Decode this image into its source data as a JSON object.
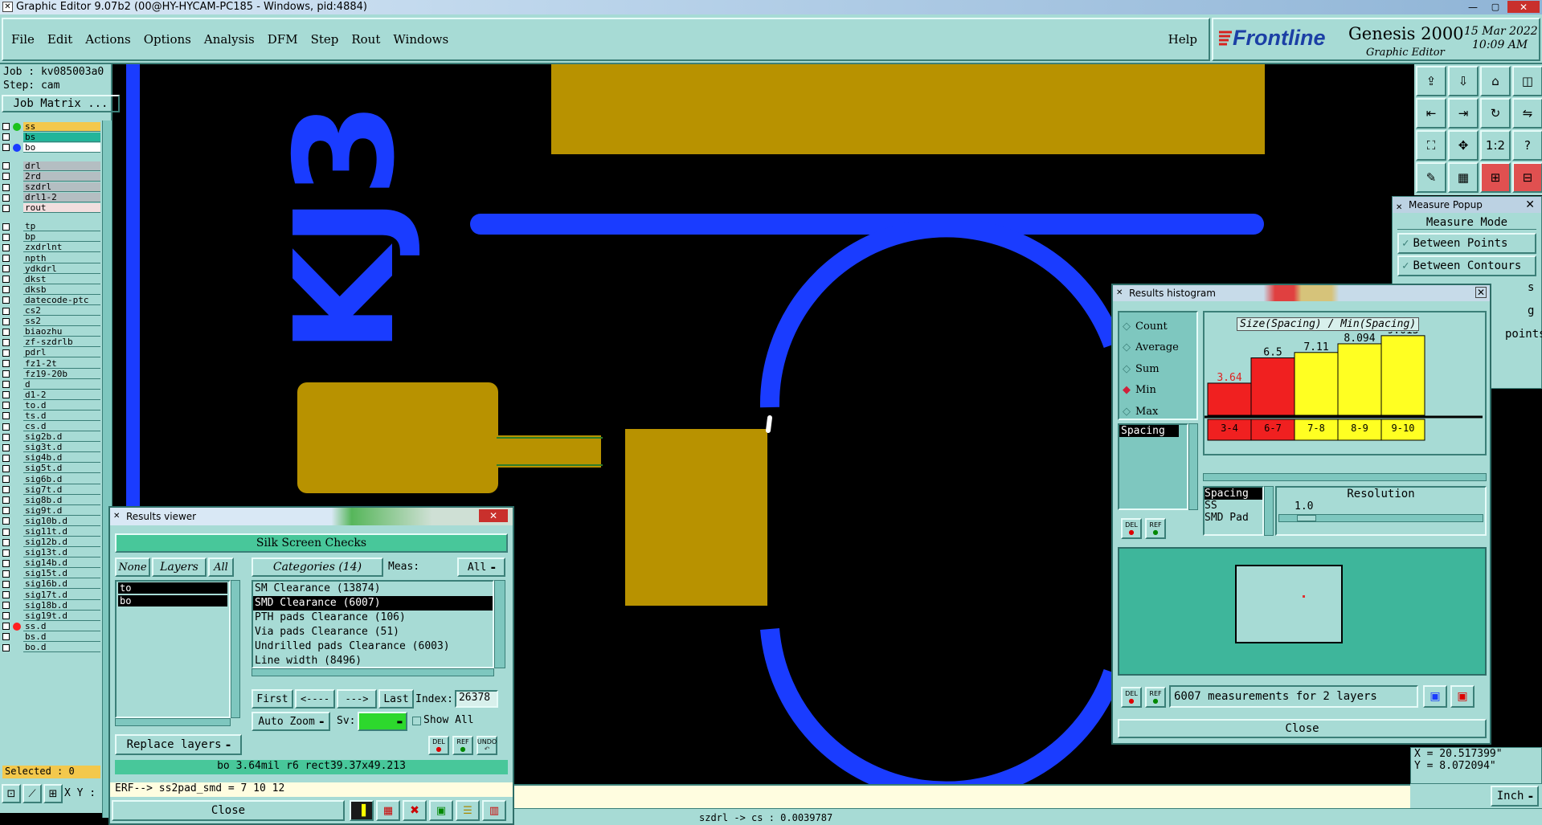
{
  "window": {
    "title": "Graphic Editor 9.07b2 (00@HY-HYCAM-PC185 - Windows, pid:4884)"
  },
  "menubar": {
    "items": [
      "File",
      "Edit",
      "Actions",
      "Options",
      "Analysis",
      "DFM",
      "Step",
      "Rout",
      "Windows"
    ],
    "help": "Help"
  },
  "brand": {
    "logo": "Frontline",
    "product": "Genesis 2000",
    "subtitle": "Graphic Editor",
    "date": "15 Mar 2022",
    "time": "10:09 AM"
  },
  "job": {
    "job": "Job : kv085003a0",
    "step": "Step: cam",
    "matrix_button": "Job Matrix ...",
    "selected": "Selected : 0"
  },
  "layers": [
    {
      "name": "ss",
      "bg": "#f3c84c",
      "dot": "#1cc21c",
      "flag": "="
    },
    {
      "name": "bs",
      "bg": "#22b59a",
      "dot": "",
      "flag": ""
    },
    {
      "name": "bo",
      "bg": "#ffffff",
      "dot": "#1a3cff",
      "flag": "◢"
    },
    {
      "name": "drl",
      "bg": "#b4bec2",
      "dot": "",
      "flag": ""
    },
    {
      "name": "2rd",
      "bg": "#b4bec2",
      "dot": "",
      "flag": ""
    },
    {
      "name": "szdrl",
      "bg": "#b4bec2",
      "dot": "",
      "flag": ""
    },
    {
      "name": "drl1-2",
      "bg": "#b4bec2",
      "dot": "",
      "flag": ""
    },
    {
      "name": "rout",
      "bg": "#f2dede",
      "dot": "",
      "flag": ""
    },
    {
      "name": "tp",
      "bg": "#a7dbd5",
      "dot": "",
      "flag": ""
    },
    {
      "name": "bp",
      "bg": "#a7dbd5",
      "dot": "",
      "flag": ""
    },
    {
      "name": "zxdrlnt",
      "bg": "#a7dbd5",
      "dot": "",
      "flag": ""
    },
    {
      "name": "npth",
      "bg": "#a7dbd5",
      "dot": "",
      "flag": ""
    },
    {
      "name": "ydkdrl",
      "bg": "#a7dbd5",
      "dot": "",
      "flag": ""
    },
    {
      "name": "dkst",
      "bg": "#a7dbd5",
      "dot": "",
      "flag": ""
    },
    {
      "name": "dksb",
      "bg": "#a7dbd5",
      "dot": "",
      "flag": ""
    },
    {
      "name": "datecode-ptc",
      "bg": "#a7dbd5",
      "dot": "",
      "flag": ""
    },
    {
      "name": "cs2",
      "bg": "#a7dbd5",
      "dot": "",
      "flag": ""
    },
    {
      "name": "ss2",
      "bg": "#a7dbd5",
      "dot": "",
      "flag": ""
    },
    {
      "name": "biaozhu",
      "bg": "#a7dbd5",
      "dot": "",
      "flag": ""
    },
    {
      "name": "zf-szdrlb",
      "bg": "#a7dbd5",
      "dot": "",
      "flag": ""
    },
    {
      "name": "pdrl",
      "bg": "#a7dbd5",
      "dot": "",
      "flag": ""
    },
    {
      "name": "fz1-2t",
      "bg": "#a7dbd5",
      "dot": "",
      "flag": ""
    },
    {
      "name": "fz19-20b",
      "bg": "#a7dbd5",
      "dot": "",
      "flag": ""
    },
    {
      "name": "d",
      "bg": "#a7dbd5",
      "dot": "",
      "flag": ""
    },
    {
      "name": "d1-2",
      "bg": "#a7dbd5",
      "dot": "",
      "flag": ""
    },
    {
      "name": "to.d",
      "bg": "#a7dbd5",
      "dot": "",
      "flag": "◢"
    },
    {
      "name": "ts.d",
      "bg": "#a7dbd5",
      "dot": "",
      "flag": "◢"
    },
    {
      "name": "cs.d",
      "bg": "#a7dbd5",
      "dot": "",
      "flag": ""
    },
    {
      "name": "sig2b.d",
      "bg": "#a7dbd5",
      "dot": "",
      "flag": ""
    },
    {
      "name": "sig3t.d",
      "bg": "#a7dbd5",
      "dot": "",
      "flag": ""
    },
    {
      "name": "sig4b.d",
      "bg": "#a7dbd5",
      "dot": "",
      "flag": ""
    },
    {
      "name": "sig5t.d",
      "bg": "#a7dbd5",
      "dot": "",
      "flag": ""
    },
    {
      "name": "sig6b.d",
      "bg": "#a7dbd5",
      "dot": "",
      "flag": ""
    },
    {
      "name": "sig7t.d",
      "bg": "#a7dbd5",
      "dot": "",
      "flag": ""
    },
    {
      "name": "sig8b.d",
      "bg": "#a7dbd5",
      "dot": "",
      "flag": ""
    },
    {
      "name": "sig9t.d",
      "bg": "#a7dbd5",
      "dot": "",
      "flag": ""
    },
    {
      "name": "sig10b.d",
      "bg": "#a7dbd5",
      "dot": "",
      "flag": ""
    },
    {
      "name": "sig11t.d",
      "bg": "#a7dbd5",
      "dot": "",
      "flag": ""
    },
    {
      "name": "sig12b.d",
      "bg": "#a7dbd5",
      "dot": "",
      "flag": ""
    },
    {
      "name": "sig13t.d",
      "bg": "#a7dbd5",
      "dot": "",
      "flag": ""
    },
    {
      "name": "sig14b.d",
      "bg": "#a7dbd5",
      "dot": "",
      "flag": ""
    },
    {
      "name": "sig15t.d",
      "bg": "#a7dbd5",
      "dot": "",
      "flag": ""
    },
    {
      "name": "sig16b.d",
      "bg": "#a7dbd5",
      "dot": "",
      "flag": ""
    },
    {
      "name": "sig17t.d",
      "bg": "#a7dbd5",
      "dot": "",
      "flag": ""
    },
    {
      "name": "sig18b.d",
      "bg": "#a7dbd5",
      "dot": "",
      "flag": ""
    },
    {
      "name": "sig19t.d",
      "bg": "#a7dbd5",
      "dot": "",
      "flag": ""
    },
    {
      "name": "ss.d",
      "bg": "#a7dbd5",
      "dot": "#ff2020",
      "flag": ""
    },
    {
      "name": "bs.d",
      "bg": "#a7dbd5",
      "dot": "",
      "flag": ""
    },
    {
      "name": "bo.d",
      "bg": "#a7dbd5",
      "dot": "",
      "flag": "◢"
    }
  ],
  "canvas": {
    "silk_text": "KJ3",
    "colors": {
      "pad": "#b89200",
      "silk": "#1a3cff"
    }
  },
  "results_viewer": {
    "title": "Results viewer",
    "header": "Silk Screen Checks",
    "none": "None",
    "layers": "Layers",
    "all": "All",
    "categories": "Categories (14)",
    "meas_label": "Meas:",
    "meas_value": "All",
    "layer_list": [
      "to",
      "bo"
    ],
    "category_list": [
      "SM Clearance (13874)",
      "SMD Clearance (6007)",
      "PTH pads Clearance (106)",
      "Via pads Clearance (51)",
      "Undrilled pads Clearance (6003)",
      "Line width (8496)"
    ],
    "first": "First",
    "prev": "<----",
    "next": "--->",
    "last": "Last",
    "index_label": "Index:",
    "index_value": "26378",
    "auto_zoom": "Auto Zoom",
    "sv": "Sv:",
    "show_all": "Show All",
    "replace_layers": "Replace layers",
    "close": "Close",
    "status": "bo 3.64mil  r6  rect39.37x49.213",
    "del": "DEL",
    "ref": "REF",
    "undo": "UNDO"
  },
  "histogram": {
    "title": "Results histogram",
    "chart_title": "Size(Spacing) / Min(Spacing)",
    "options": [
      "Count",
      "Average",
      "Sum",
      "Min",
      "Max"
    ],
    "selected": "Min",
    "list": [
      "Spacing"
    ],
    "resolution_label": "Resolution",
    "resolution_value": "1.0",
    "meas_list": [
      "Spacing",
      "SS",
      "SMD Pad"
    ],
    "summary": "6007 measurements for 2 layers",
    "close": "Close",
    "del": "DEL",
    "ref": "REF"
  },
  "chart_data": {
    "type": "bar",
    "title": "Size(Spacing) / Min(Spacing)",
    "categories": [
      "3-4",
      "6-7",
      "7-8",
      "8-9",
      "9-10"
    ],
    "values": [
      3.64,
      6.5,
      7.11,
      8.094,
      9.013
    ],
    "colors": [
      "#f02020",
      "#f02020",
      "#ffff22",
      "#ffff22",
      "#ffff22"
    ],
    "ylim": [
      0,
      10
    ]
  },
  "measure_popup": {
    "title": "Measure Popup",
    "mode": "Measure Mode",
    "items": [
      "Between Points",
      "Between Contours"
    ],
    "partial": [
      "s",
      "g",
      "points"
    ]
  },
  "coords": {
    "x": "X = 20.517399\"",
    "y": "Y = 8.072094\""
  },
  "bottom": {
    "erf": "ERF--> ss2pad_smd = 7 10 12",
    "xy": "X Y :",
    "units": "Inch",
    "status": "szdrl -> cs : 0.0039787"
  }
}
